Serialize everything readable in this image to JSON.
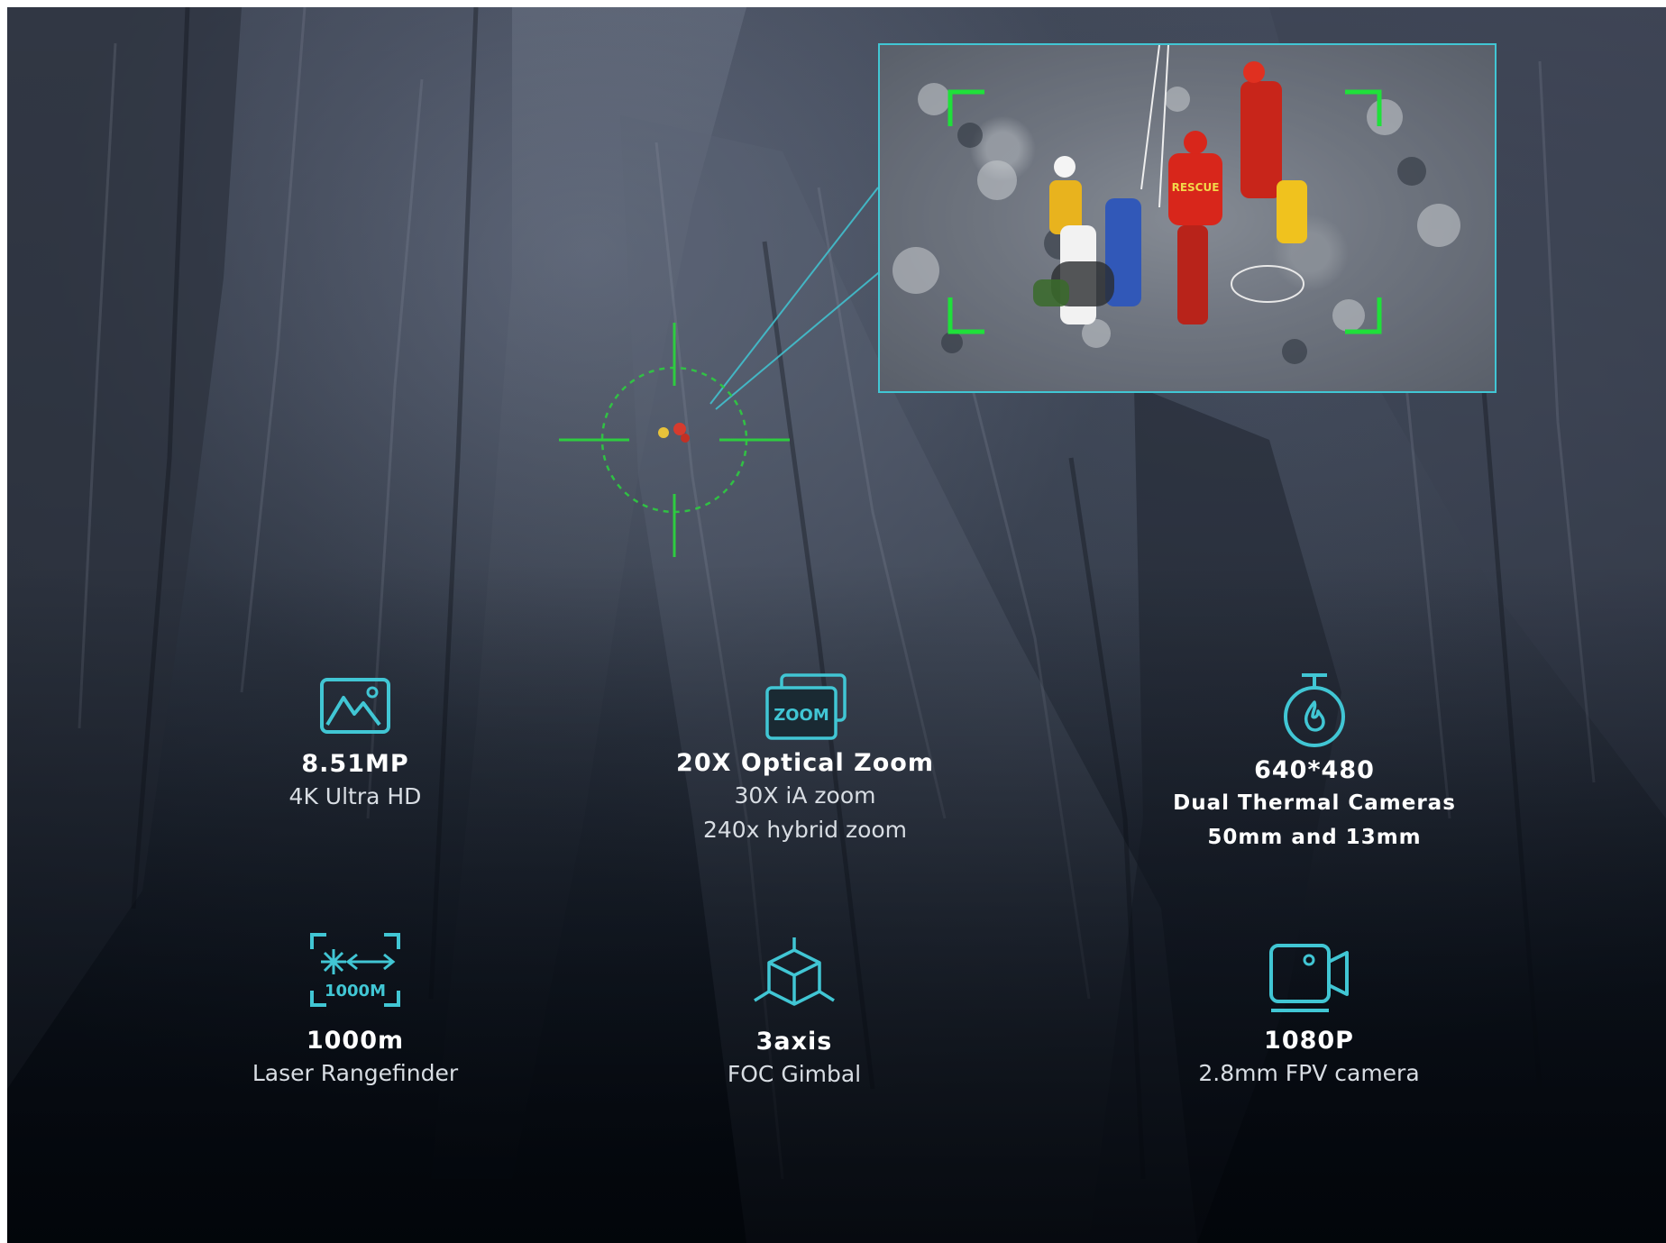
{
  "colors": {
    "accent": "#41c6d4",
    "reticle": "#2ecc40",
    "bracket": "#1fe03a",
    "text": "#ffffff"
  },
  "zoom_inset": {
    "badge_text": "RESCUE"
  },
  "features": [
    {
      "icon": "image-icon",
      "title": "8.51MP",
      "lines": [
        "4K Ultra HD"
      ]
    },
    {
      "icon": "zoom-icon",
      "icon_text": "ZOOM",
      "title": "20X Optical Zoom",
      "lines": [
        "30X iA zoom",
        "240x hybrid zoom"
      ]
    },
    {
      "icon": "thermal-camera-icon",
      "title": "640*480",
      "lines": [
        "Dual Thermal Cameras",
        "50mm and 13mm"
      ]
    },
    {
      "icon": "laser-rangefinder-icon",
      "icon_text": "1000M",
      "title": "1000m",
      "lines": [
        "Laser Rangefinder"
      ]
    },
    {
      "icon": "gimbal-cube-icon",
      "title": "3axis",
      "lines": [
        "FOC Gimbal"
      ]
    },
    {
      "icon": "fpv-camera-icon",
      "title": "1080P",
      "lines": [
        "2.8mm FPV camera"
      ]
    }
  ]
}
